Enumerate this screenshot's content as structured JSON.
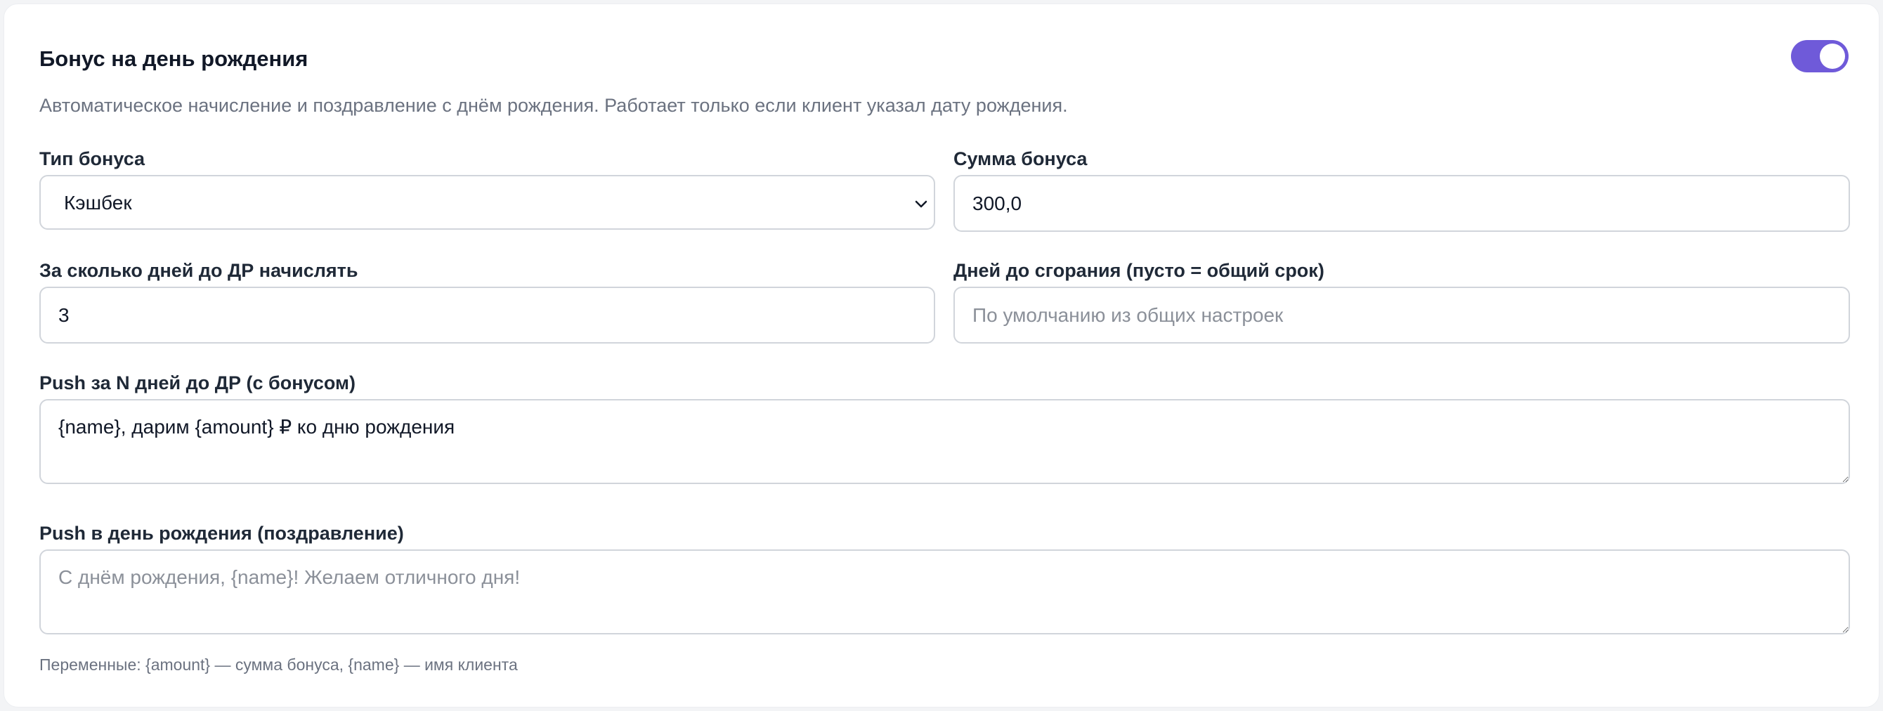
{
  "section": {
    "title": "Бонус на день рождения",
    "description": "Автоматическое начисление и поздравление с днём рождения. Работает только если клиент указал дату рождения.",
    "enabled": true
  },
  "bonus_type": {
    "label": "Тип бонуса",
    "selected": "Кэшбек"
  },
  "bonus_amount": {
    "label": "Сумма бонуса",
    "value": "300,0"
  },
  "days_before": {
    "label": "За сколько дней до ДР начислять",
    "value": "3"
  },
  "expire_days": {
    "label": "Дней до сгорания (пусто = общий срок)",
    "value": "",
    "placeholder": "По умолчанию из общих настроек"
  },
  "push_before": {
    "label": "Push за N дней до ДР (с бонусом)",
    "value": "{name}, дарим {amount} ₽ ко дню рождения"
  },
  "push_birthday": {
    "label": "Push в день рождения (поздравление)",
    "value": "",
    "placeholder": "С днём рождения, {name}! Желаем отличного дня!"
  },
  "hint": "Переменные: {amount} — сумма бонуса, {name} — имя клиента",
  "colors": {
    "accent": "#6f5ad9",
    "border": "#d1d5db",
    "muted_text": "#6b7280"
  }
}
